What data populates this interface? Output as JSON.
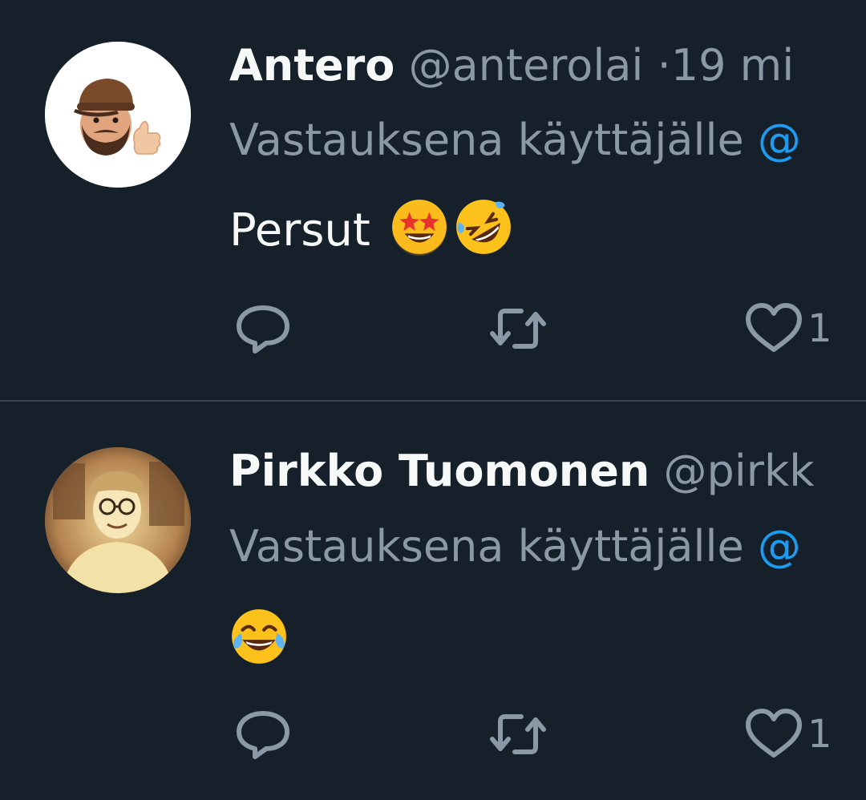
{
  "tweets": [
    {
      "display_name": "Antero",
      "handle": "@anterolai",
      "separator": "·",
      "time": "19 mi",
      "reply_prefix": "Vastauksena käyttäjälle",
      "reply_mention": "@",
      "text": "Persut",
      "emojis": [
        "star-struck-emoji",
        "rolling-on-floor-laughing-emoji"
      ],
      "actions": {
        "reply_icon": "reply-icon",
        "retweet_icon": "retweet-icon",
        "like_icon": "heart-icon",
        "like_count": "1"
      }
    },
    {
      "display_name": "Pirkko Tuomonen",
      "handle": "@pirkk",
      "reply_prefix": "Vastauksena käyttäjälle",
      "reply_mention": "@",
      "text": "",
      "emojis": [
        "face-with-tears-of-joy-emoji"
      ],
      "actions": {
        "reply_icon": "reply-icon",
        "retweet_icon": "retweet-icon",
        "like_icon": "heart-icon",
        "like_count": "1"
      }
    }
  ],
  "colors": {
    "background": "#15202b",
    "primary_text": "#f7f9f9",
    "secondary_text": "#8b98a5",
    "accent": "#1d9bf0",
    "divider": "#38444d"
  }
}
